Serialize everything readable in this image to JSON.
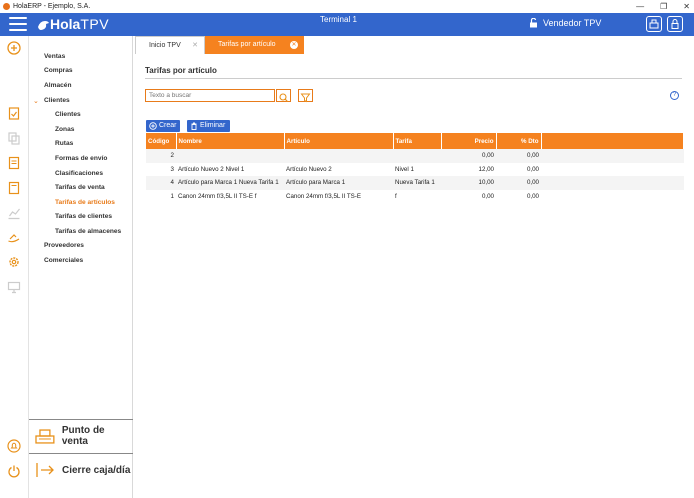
{
  "window": {
    "title": "HolaERP - Ejemplo, S.A."
  },
  "header": {
    "logo_hola": "Hola",
    "logo_tpv": "TPV",
    "terminal": "Terminal 1",
    "user": "Vendedor TPV"
  },
  "nav": {
    "items": [
      {
        "label": "Ventas"
      },
      {
        "label": "Compras"
      },
      {
        "label": "Almacén"
      },
      {
        "label": "Clientes"
      },
      {
        "label": "Clientes"
      },
      {
        "label": "Zonas"
      },
      {
        "label": "Rutas"
      },
      {
        "label": "Formas de envío"
      },
      {
        "label": "Clasificaciones"
      },
      {
        "label": "Tarifas de venta"
      },
      {
        "label": "Tarifas de artículos"
      },
      {
        "label": "Tarifas de clientes"
      },
      {
        "label": "Tarifas de almacenes"
      },
      {
        "label": "Proveedores"
      },
      {
        "label": "Comerciales"
      }
    ],
    "punto_venta": "Punto de venta",
    "cierre_caja": "Cierre caja/día"
  },
  "tabs": [
    {
      "label": "Inicio TPV"
    },
    {
      "label": "Tarifas por artículo"
    }
  ],
  "page": {
    "title": "Tarifas por artículo",
    "search_placeholder": "Texto a buscar",
    "crear": "Crear",
    "eliminar": "Eliminar"
  },
  "table": {
    "headers": [
      "Código",
      "Nombre",
      "Artículo",
      "Tarifa",
      "Precio",
      "% Dto"
    ],
    "rows": [
      [
        "2",
        "",
        "",
        "",
        "0,00",
        "0,00"
      ],
      [
        "3",
        "Artículo Nuevo 2 Nivel 1",
        "Artículo Nuevo 2",
        "Nivel 1",
        "12,00",
        "0,00"
      ],
      [
        "4",
        "Artículo para Marca 1 Nueva Tarifa 1",
        "Artículo para Marca 1",
        "Nueva Tarifa 1",
        "10,00",
        "0,00"
      ],
      [
        "1",
        "Canon 24mm f/3,5L II TS-E f",
        "Canon 24mm f/3,5L II TS-E",
        "f",
        "0,00",
        "0,00"
      ]
    ]
  },
  "colors": {
    "primary": "#3366cc",
    "accent": "#f5821f"
  }
}
